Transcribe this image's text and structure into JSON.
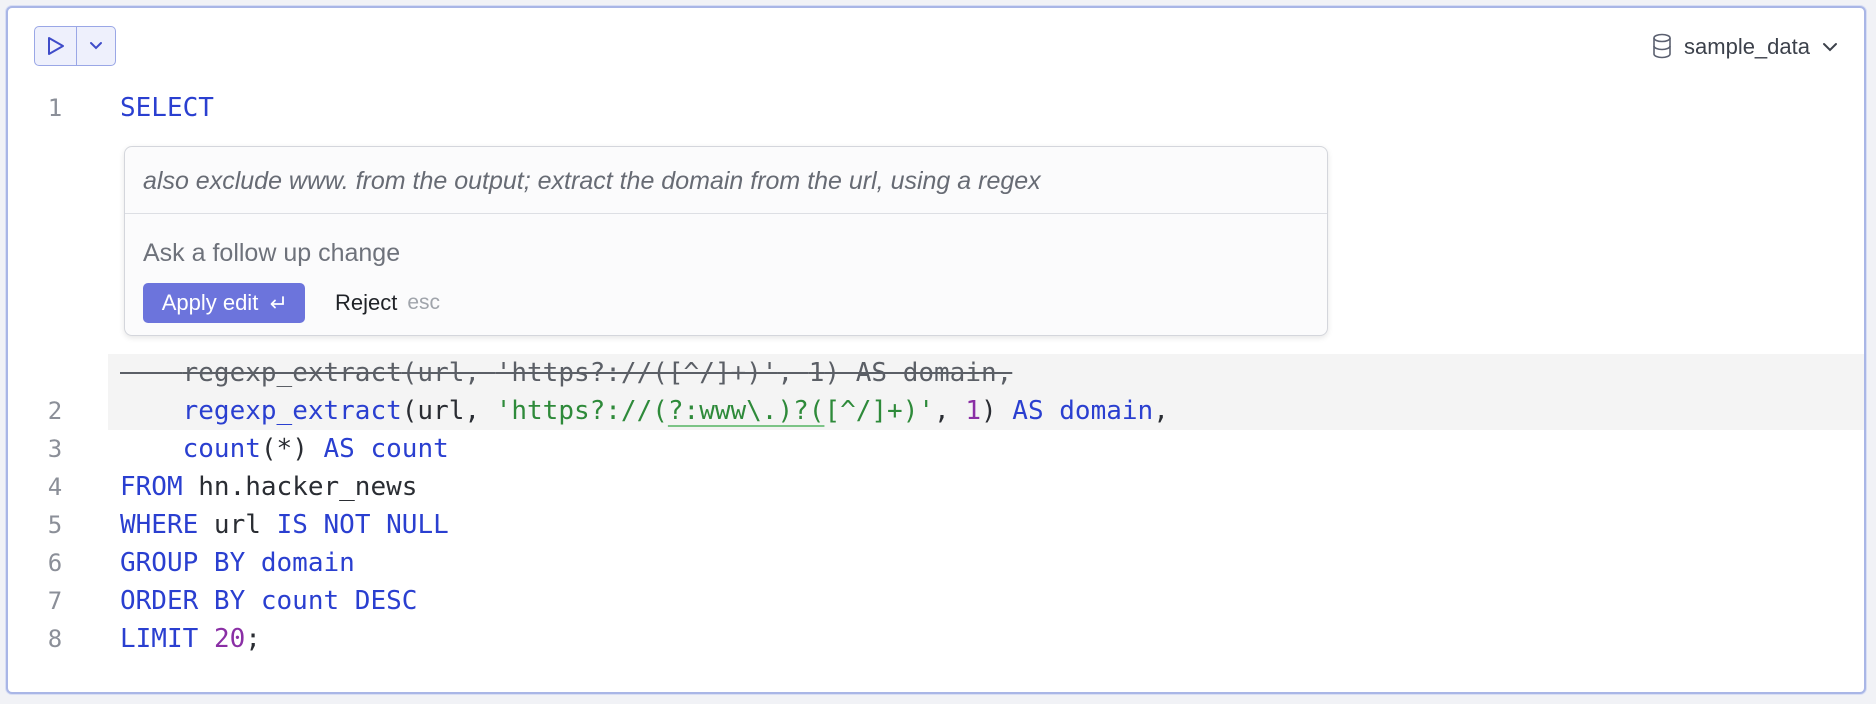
{
  "toolbar": {
    "run_icon": "play-icon",
    "run_menu_icon": "chevron-down-icon",
    "database": {
      "icon": "database-icon",
      "name": "sample_data",
      "chevron_icon": "chevron-down-icon"
    }
  },
  "editor": {
    "line1": {
      "number": "1",
      "kw": "SELECT"
    },
    "removed_line": {
      "indent": "    ",
      "fn": "regexp_extract",
      "open": "(url, ",
      "str": "'https?://([^/]+)'",
      "comma": ", ",
      "num": "1",
      "close": ") AS domain,"
    },
    "line2": {
      "number": "2",
      "indent": "    ",
      "fn": "regexp_extract",
      "open": "(url, ",
      "str_pre": "'https?://(",
      "str_ins": "?:www\\.)?(",
      "str_post": "[^/]+)'",
      "comma": ", ",
      "num": "1",
      "close_paren": ") ",
      "kw_as": "AS",
      "space": " ",
      "alias": "domain",
      "trail": ","
    },
    "line3": {
      "number": "3",
      "indent": "    ",
      "fn": "count",
      "args": "(*) ",
      "kw_as": "AS",
      "space": " ",
      "alias": "count"
    },
    "line4": {
      "number": "4",
      "kw": "FROM",
      "rest": " hn.hacker_news"
    },
    "line5": {
      "number": "5",
      "kw": "WHERE",
      "mid": " url ",
      "kw2": "IS NOT NULL"
    },
    "line6": {
      "number": "6",
      "kw": "GROUP BY domain"
    },
    "line7": {
      "number": "7",
      "kw": "ORDER BY count DESC"
    },
    "line8": {
      "number": "8",
      "kw": "LIMIT",
      "space": " ",
      "num": "20",
      "trail": ";"
    }
  },
  "ai_popup": {
    "prompt": "also exclude www. from the output; extract the domain from the url, using a regex",
    "followup_placeholder": "Ask a follow up change",
    "apply_label": "Apply edit",
    "apply_icon": "enter-icon",
    "reject_label": "Reject",
    "reject_hint": "esc"
  },
  "colors": {
    "keyword": "#2a3fd0",
    "string": "#2e8a3a",
    "number": "#8a2fa5",
    "accent": "#6c74dc",
    "frame_border": "#a9b6e6"
  }
}
